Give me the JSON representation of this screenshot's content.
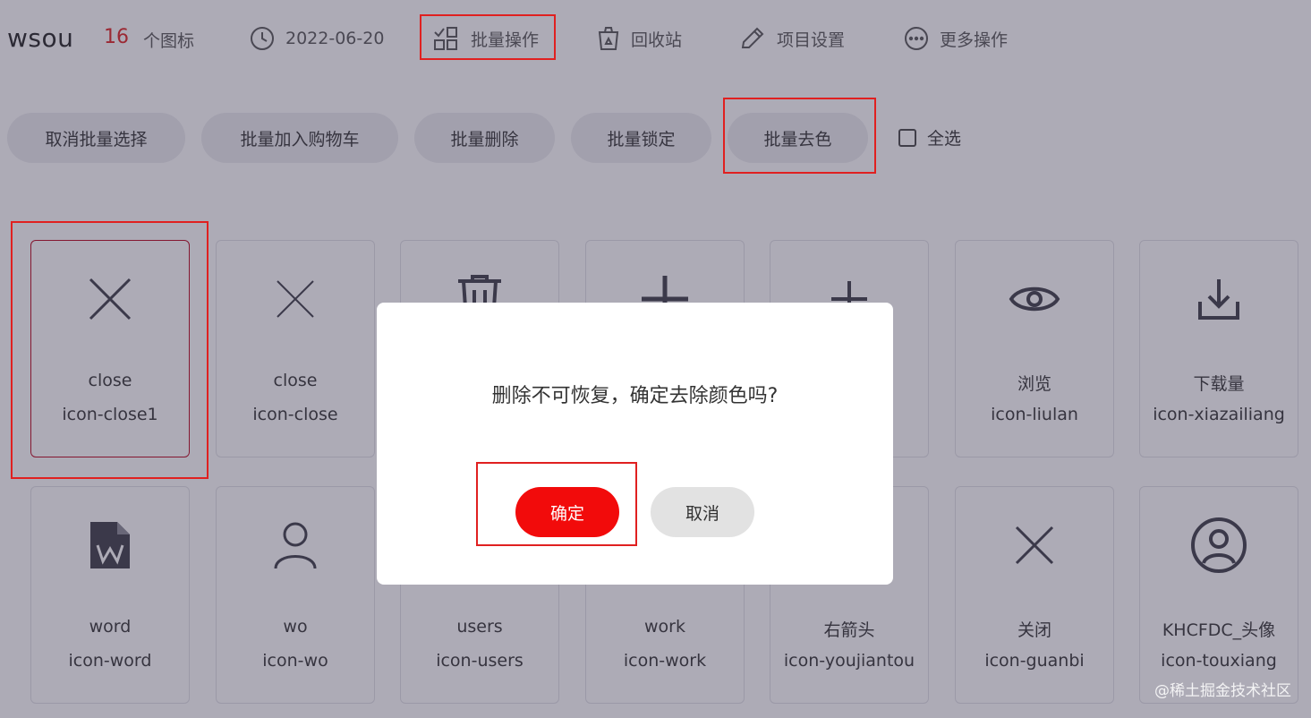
{
  "header": {
    "project_name": "wsou",
    "icon_count": "16",
    "icon_count_label": "个图标",
    "items": [
      {
        "icon": "clock-icon",
        "label": "2022-06-20"
      },
      {
        "icon": "batch-grid-icon",
        "label": "批量操作"
      },
      {
        "icon": "recycle-bin-icon",
        "label": "回收站"
      },
      {
        "icon": "pencil-icon",
        "label": "项目设置"
      },
      {
        "icon": "more-dots-icon",
        "label": "更多操作"
      }
    ]
  },
  "batch_bar": {
    "buttons": [
      "取消批量选择",
      "批量加入购物车",
      "批量删除",
      "批量锁定",
      "批量去色"
    ],
    "select_all": "全选"
  },
  "grid": {
    "cards": [
      {
        "icon": "close-icon",
        "name": "close",
        "code": "icon-close1",
        "selected": true
      },
      {
        "icon": "close-icon",
        "name": "close",
        "code": "icon-close",
        "selected": false
      },
      {
        "icon": "trash-icon",
        "name": "",
        "code": "",
        "selected": false
      },
      {
        "icon": "plus-icon",
        "name": "",
        "code": "",
        "selected": false
      },
      {
        "icon": "plus-icon",
        "name": "",
        "code": "",
        "selected": false
      },
      {
        "icon": "eye-icon",
        "name": "浏览",
        "code": "icon-liulan",
        "selected": false
      },
      {
        "icon": "download-icon",
        "name": "下载量",
        "code": "icon-xiazailiang",
        "selected": false
      },
      {
        "icon": "word-file-icon",
        "name": "word",
        "code": "icon-word",
        "selected": false
      },
      {
        "icon": "user-icon",
        "name": "wo",
        "code": "icon-wo",
        "selected": false
      },
      {
        "icon": "",
        "name": "users",
        "code": "icon-users",
        "selected": false
      },
      {
        "icon": "",
        "name": "work",
        "code": "icon-work",
        "selected": false
      },
      {
        "icon": "",
        "name": "右箭头",
        "code": "icon-youjiantou",
        "selected": false
      },
      {
        "icon": "close-icon",
        "name": "关闭",
        "code": "icon-guanbi",
        "selected": false
      },
      {
        "icon": "avatar-circle-icon",
        "name": "KHCFDC_头像",
        "code": "icon-touxiang",
        "selected": false
      }
    ]
  },
  "dialog": {
    "message": "删除不可恢复，确定去除颜色吗?",
    "confirm_label": "确定",
    "cancel_label": "取消"
  },
  "watermark": "@稀土掘金技术社区",
  "colors": {
    "accent_red": "#f20b0b",
    "highlight_red": "#e02020",
    "icon_dark": "#3c3c46",
    "overlay": "rgba(60,56,80,0.42)"
  }
}
